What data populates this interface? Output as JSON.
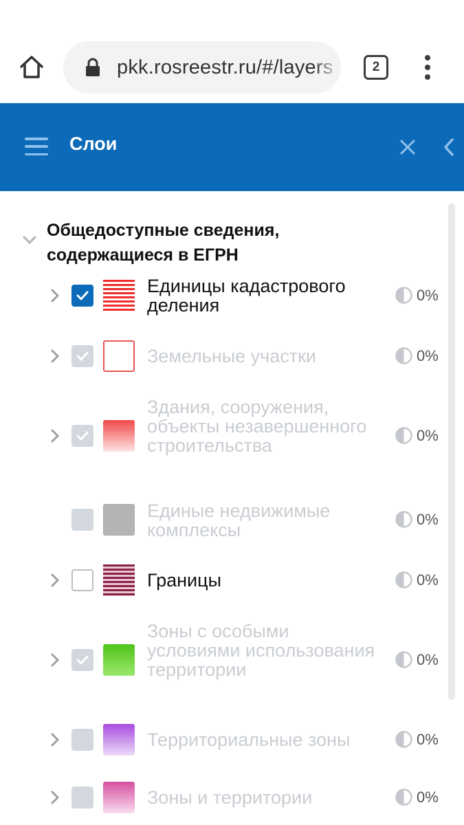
{
  "browser": {
    "url": "pkk.rosreestr.ru/#/layers",
    "tab_count": "2"
  },
  "header": {
    "title": "Слои"
  },
  "group": {
    "title": "Общедоступные сведения, содержащиеся в ЕГРН"
  },
  "layers": [
    {
      "label": "Единицы кадастрового деления",
      "opacity": "0%",
      "checked": true,
      "enabled": true,
      "expandable": true,
      "swatch": "red-stripes"
    },
    {
      "label": "Земельные участки",
      "opacity": "0%",
      "checked": true,
      "enabled": false,
      "expandable": true,
      "swatch": "red-outline"
    },
    {
      "label": "Здания, сооружения, объекты незавершенного строительства",
      "opacity": "0%",
      "checked": true,
      "enabled": false,
      "expandable": true,
      "swatch": "red-gradient"
    },
    {
      "label": "Единые недвижимые комплексы",
      "opacity": "0%",
      "checked": false,
      "enabled": false,
      "expandable": false,
      "swatch": "grey"
    },
    {
      "label": "Границы",
      "opacity": "0%",
      "checked": false,
      "enabled": true,
      "expandable": true,
      "swatch": "maroon-stripes"
    },
    {
      "label": "Зоны с особыми условиями использования территории",
      "opacity": "0%",
      "checked": true,
      "enabled": false,
      "expandable": true,
      "swatch": "green"
    },
    {
      "label": "Территориальные зоны",
      "opacity": "0%",
      "checked": false,
      "enabled": false,
      "expandable": true,
      "swatch": "purple"
    },
    {
      "label": "Зоны и территории",
      "opacity": "0%",
      "checked": false,
      "enabled": false,
      "expandable": true,
      "swatch": "pink"
    }
  ],
  "colors": {
    "header_bg": "#0c6bb8",
    "checkbox_active": "#0c6bb8",
    "disabled_text": "#c9cdd2"
  }
}
